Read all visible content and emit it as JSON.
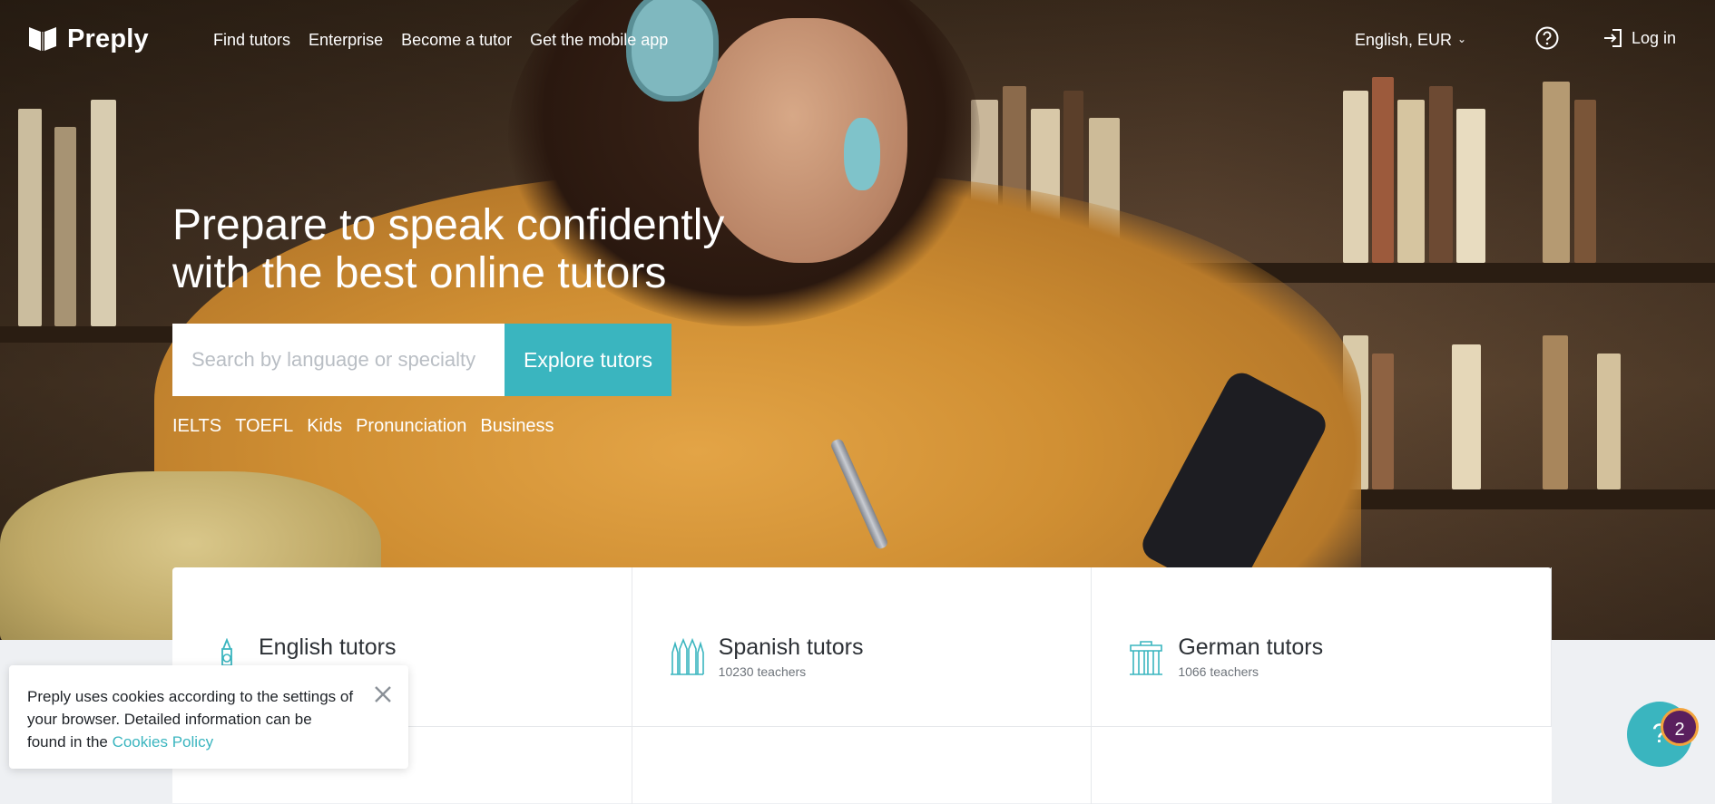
{
  "brand": {
    "name": "Preply"
  },
  "nav": {
    "items": [
      "Find tutors",
      "Enterprise",
      "Become a tutor",
      "Get the mobile app"
    ],
    "language_currency": "English, EUR",
    "login_label": "Log in"
  },
  "hero": {
    "title_line1": "Prepare to speak confidently",
    "title_line2": "with the best online tutors",
    "search_placeholder": "Search by language or specialty",
    "explore_label": "Explore tutors",
    "tags": [
      "IELTS",
      "TOEFL",
      "Kids",
      "Pronunciation",
      "Business"
    ]
  },
  "categories": [
    {
      "name": "English tutors",
      "count": "",
      "icon": "big-ben-icon"
    },
    {
      "name": "Spanish tutors",
      "count": "10230 teachers",
      "icon": "sagrada-familia-icon"
    },
    {
      "name": "German tutors",
      "count": "1066 teachers",
      "icon": "brandenburg-gate-icon"
    }
  ],
  "cookie": {
    "text": "Preply uses cookies according to the settings of your browser. Detailed information can be found in the ",
    "link": "Cookies Policy"
  },
  "chat": {
    "icon_label": "?",
    "badge_count": "2"
  },
  "colors": {
    "accent": "#3ab5bf",
    "badge": "#5a1f5e",
    "badge_border": "#f2a33c"
  }
}
